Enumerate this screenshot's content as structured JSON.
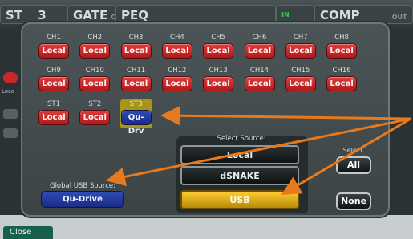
{
  "background": {
    "channel_label": "ST",
    "channel_number": "3",
    "tabs": [
      {
        "label": "GATE",
        "sub": "OUT"
      },
      {
        "label": "PEQ",
        "sub": ""
      },
      {
        "label": "IN",
        "sub": ""
      },
      {
        "label": "COMP",
        "sub": "OUT"
      }
    ],
    "left_strip_text": "Loca",
    "close_label": "Close"
  },
  "channels": [
    {
      "name": "CH1",
      "source": "Local",
      "selected": false
    },
    {
      "name": "CH2",
      "source": "Local",
      "selected": false
    },
    {
      "name": "CH3",
      "source": "Local",
      "selected": false
    },
    {
      "name": "CH4",
      "source": "Local",
      "selected": false
    },
    {
      "name": "CH5",
      "source": "Local",
      "selected": false
    },
    {
      "name": "CH6",
      "source": "Local",
      "selected": false
    },
    {
      "name": "CH7",
      "source": "Local",
      "selected": false
    },
    {
      "name": "CH8",
      "source": "Local",
      "selected": false
    },
    {
      "name": "CH9",
      "source": "Local",
      "selected": false
    },
    {
      "name": "CH10",
      "source": "Local",
      "selected": false
    },
    {
      "name": "CH11",
      "source": "Local",
      "selected": false
    },
    {
      "name": "CH12",
      "source": "Local",
      "selected": false
    },
    {
      "name": "CH13",
      "source": "Local",
      "selected": false
    },
    {
      "name": "CH14",
      "source": "Local",
      "selected": false
    },
    {
      "name": "CH15",
      "source": "Local",
      "selected": false
    },
    {
      "name": "CH16",
      "source": "Local",
      "selected": false
    },
    {
      "name": "ST1",
      "source": "Local",
      "selected": false
    },
    {
      "name": "ST2",
      "source": "Local",
      "selected": false
    },
    {
      "name": "ST3",
      "source": "Qu-Drv",
      "selected": true
    }
  ],
  "global_usb": {
    "label": "Global USB Source:",
    "value": "Qu-Drive"
  },
  "select_source": {
    "label": "Select Source:",
    "options": [
      {
        "label": "Local",
        "active": false
      },
      {
        "label": "dSNAKE",
        "active": false
      },
      {
        "label": "USB",
        "active": true
      }
    ]
  },
  "select": {
    "label": "Select",
    "all_label": "All",
    "none_label": "None"
  },
  "colors": {
    "local_button": "#d02828",
    "usb_button": "#23399e",
    "selected_highlight": "#a89418",
    "active_source": "#f0b820",
    "callout_arrow": "#e87a1e",
    "dialog_bg": "#454e50"
  }
}
